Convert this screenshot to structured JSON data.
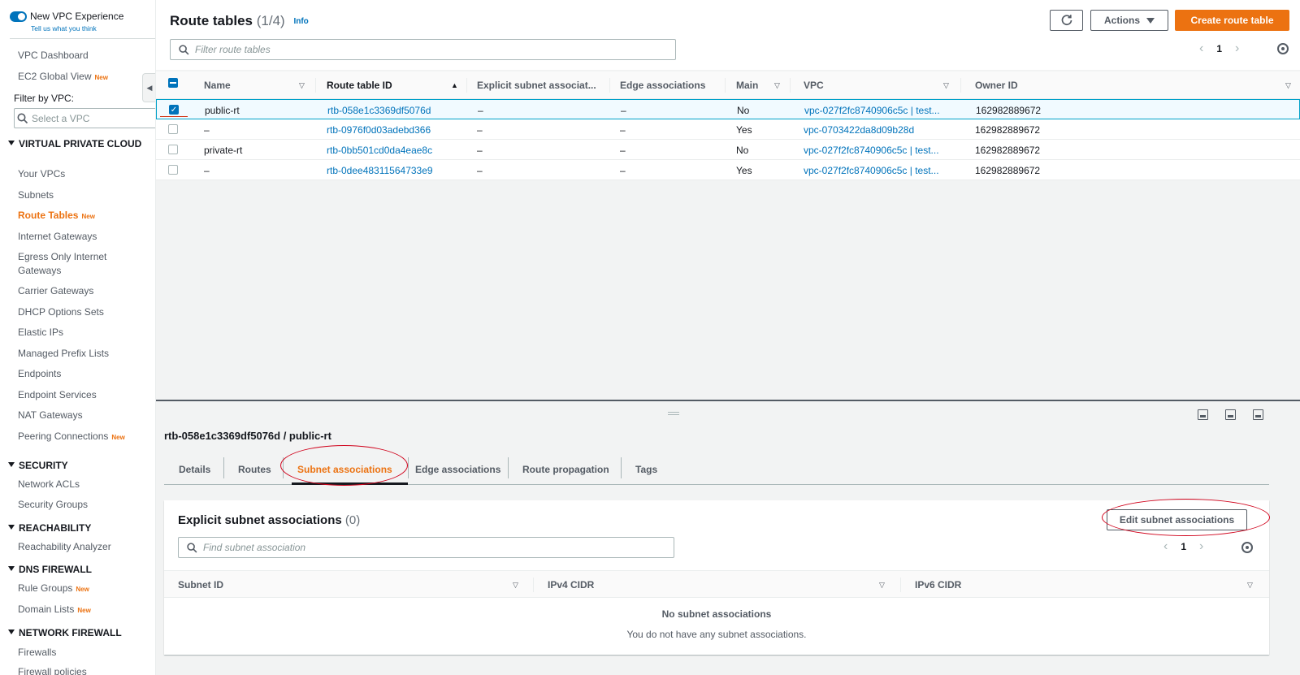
{
  "sidebar": {
    "toggle_label": "New VPC Experience",
    "feedback_link": "Tell us what you think",
    "top_items": [
      {
        "label": "VPC Dashboard",
        "badge": ""
      },
      {
        "label": "EC2 Global View",
        "badge": "New"
      }
    ],
    "filter_label": "Filter by VPC:",
    "vpc_select_placeholder": "Select a VPC",
    "sections": [
      {
        "title": "VIRTUAL PRIVATE CLOUD",
        "items": [
          {
            "label": "Your VPCs",
            "badge": ""
          },
          {
            "label": "Subnets",
            "badge": ""
          },
          {
            "label": "Route Tables",
            "badge": "New",
            "active": true
          },
          {
            "label": "Internet Gateways",
            "badge": ""
          },
          {
            "label": "Egress Only Internet Gateways",
            "badge": ""
          },
          {
            "label": "Carrier Gateways",
            "badge": ""
          },
          {
            "label": "DHCP Options Sets",
            "badge": ""
          },
          {
            "label": "Elastic IPs",
            "badge": ""
          },
          {
            "label": "Managed Prefix Lists",
            "badge": ""
          },
          {
            "label": "Endpoints",
            "badge": ""
          },
          {
            "label": "Endpoint Services",
            "badge": ""
          },
          {
            "label": "NAT Gateways",
            "badge": ""
          },
          {
            "label": "Peering Connections",
            "badge": "New"
          }
        ]
      },
      {
        "title": "SECURITY",
        "items": [
          {
            "label": "Network ACLs",
            "badge": ""
          },
          {
            "label": "Security Groups",
            "badge": ""
          }
        ]
      },
      {
        "title": "REACHABILITY",
        "items": [
          {
            "label": "Reachability Analyzer",
            "badge": ""
          }
        ]
      },
      {
        "title": "DNS FIREWALL",
        "items": [
          {
            "label": "Rule Groups",
            "badge": "New"
          },
          {
            "label": "Domain Lists",
            "badge": "New"
          }
        ]
      },
      {
        "title": "NETWORK FIREWALL",
        "items": [
          {
            "label": "Firewalls",
            "badge": ""
          },
          {
            "label": "Firewall policies",
            "badge": ""
          }
        ]
      }
    ]
  },
  "header": {
    "title": "Route tables",
    "count": "(1/4)",
    "info_link": "Info",
    "refresh_icon": "refresh-icon",
    "actions_label": "Actions",
    "create_label": "Create route table",
    "search_placeholder": "Filter route tables",
    "page_number": "1"
  },
  "table": {
    "columns": [
      "Name",
      "Route table ID",
      "Explicit subnet associat...",
      "Edge associations",
      "Main",
      "VPC",
      "Owner ID"
    ],
    "rows": [
      {
        "selected": true,
        "name": "public-rt",
        "id": "rtb-058e1c3369df5076d",
        "explicit": "–",
        "edge": "–",
        "main": "No",
        "vpc": "vpc-027f2fc8740906c5c | test...",
        "owner": "162982889672"
      },
      {
        "selected": false,
        "name": "–",
        "id": "rtb-0976f0d03adebd366",
        "explicit": "–",
        "edge": "–",
        "main": "Yes",
        "vpc": "vpc-0703422da8d09b28d",
        "owner": "162982889672"
      },
      {
        "selected": false,
        "name": "private-rt",
        "id": "rtb-0bb501cd0da4eae8c",
        "explicit": "–",
        "edge": "–",
        "main": "No",
        "vpc": "vpc-027f2fc8740906c5c | test...",
        "owner": "162982889672"
      },
      {
        "selected": false,
        "name": "–",
        "id": "rtb-0dee48311564733e9",
        "explicit": "–",
        "edge": "–",
        "main": "Yes",
        "vpc": "vpc-027f2fc8740906c5c | test...",
        "owner": "162982889672"
      }
    ]
  },
  "details": {
    "title": "rtb-058e1c3369df5076d / public-rt",
    "tabs": [
      "Details",
      "Routes",
      "Subnet associations",
      "Edge associations",
      "Route propagation",
      "Tags"
    ],
    "active_tab": "Subnet associations",
    "panel_title": "Explicit subnet associations",
    "panel_count": "(0)",
    "edit_button": "Edit subnet associations",
    "search_placeholder": "Find subnet association",
    "page_number": "1",
    "columns": [
      "Subnet ID",
      "IPv4 CIDR",
      "IPv6 CIDR"
    ],
    "empty_title": "No subnet associations",
    "empty_desc": "You do not have any subnet associations."
  },
  "colors": {
    "accent": "#ec7211",
    "link": "#0073bb",
    "annotation": "#d0021b"
  }
}
